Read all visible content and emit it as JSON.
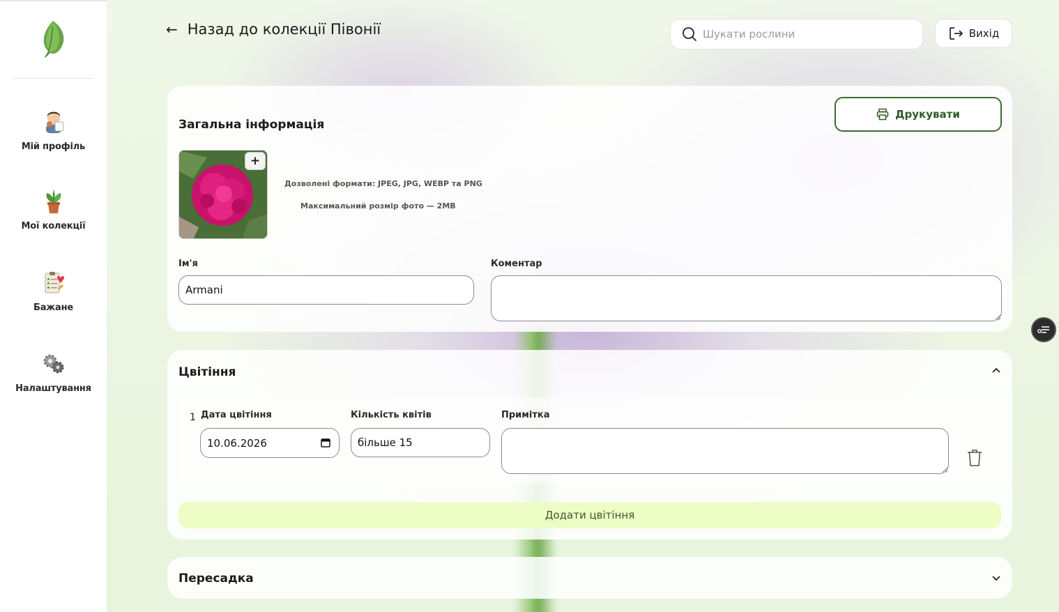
{
  "sidebar": {
    "items": [
      {
        "label": "Мій профіль"
      },
      {
        "label": "Мої колекції"
      },
      {
        "label": "Бажане"
      },
      {
        "label": "Налаштування"
      }
    ]
  },
  "header": {
    "back_label": "Назад до колекції Півонії",
    "search_placeholder": "Шукати рослини",
    "logout_label": "Вихід"
  },
  "general": {
    "title": "Загальна інформація",
    "print_label": "Друкувати",
    "photo_add": "+",
    "formats_hint": "Дозволені формати: JPEG, JPG, WEBP та PNG",
    "size_hint": "Максимальний розмір фото — 2MB",
    "name_label": "Ім'я",
    "name_value": "Armani",
    "comment_label": "Коментар",
    "comment_value": ""
  },
  "blooming": {
    "title": "Цвітіння",
    "rows": [
      {
        "index": "1",
        "date_label": "Дата цвітіння",
        "date_value": "10.06.2026",
        "count_label": "Кількість квітів",
        "count_value": "більше 15",
        "note_label": "Примітка",
        "note_value": ""
      }
    ],
    "add_label": "Додати цвітіння"
  },
  "transplant": {
    "title": "Пересадка"
  },
  "colors": {
    "accent_green": "#3c6b2e",
    "add_button_bg": "#eefcc5",
    "background": "#eaf7dc"
  }
}
